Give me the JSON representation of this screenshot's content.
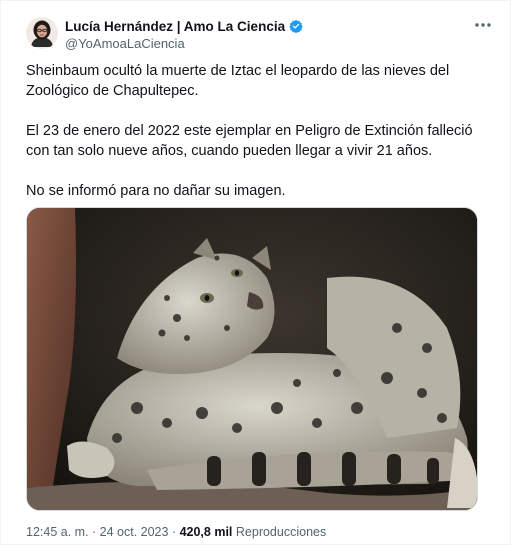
{
  "author": {
    "display_name": "Lucía Hernández | Amo La Ciencia",
    "handle": "@YoAmoaLaCiencia",
    "verified_icon": "verified-badge-icon",
    "verified_color": "#1d9bf0"
  },
  "tweet": {
    "paragraphs": [
      "Sheinbaum ocultó la muerte de Iztac el leopardo de las nieves del Zoológico de Chapultepec.",
      "El 23 de enero del 2022 este ejemplar en Peligro de Extinción falleció con tan solo nueve años, cuando pueden llegar a vivir 21 años.",
      "No se informó para no dañar su imagen."
    ],
    "media_icon": "photo-snow-leopard"
  },
  "meta": {
    "time": "12:45 a. m.",
    "separator": " · ",
    "date": "24 oct. 2023",
    "views_count": "420,8 mil",
    "views_label": "Reproducciones"
  },
  "colors": {
    "text": "#0f1419",
    "secondary": "#536471",
    "border": "#cfd9de"
  }
}
